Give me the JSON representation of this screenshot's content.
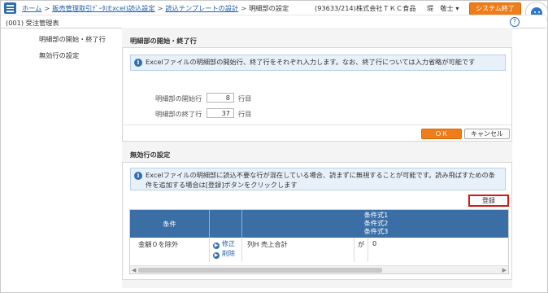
{
  "header": {
    "breadcrumbs": [
      {
        "label": "ホーム"
      },
      {
        "label": "販売管理取引ﾃﾞｰﾀ(Excel)読込設定"
      },
      {
        "label": "読込テンプレートの設計"
      }
    ],
    "current": "明細部の設定",
    "company": "(93633/214)株式会社ＴＫＣ食品",
    "user": "堤　敬士 ▾",
    "system_end_label": "システム終了"
  },
  "subheader": {
    "title": "(001) 受注管理表",
    "help_label": "?"
  },
  "leftnav": {
    "items": [
      {
        "label": "明細部の開始・終了行"
      },
      {
        "label": "無効行の設定"
      }
    ]
  },
  "detail_section": {
    "title": "明細部の開始・終了行",
    "info": "Excelファイルの明細部の開始行、終了行をそれぞれ入力します。なお、終了行については入力省略が可能です",
    "start_label": "明細部の開始行",
    "start_value": "8",
    "end_label": "明細部の終了行",
    "end_value": "37",
    "unit": "行目",
    "ok_label": "ＯＫ",
    "cancel_label": "キャンセル"
  },
  "invalid_section": {
    "title": "無効行の設定",
    "info_line1": "Excelファイルの明細部に読込不要な行が混在している場合、読まずに無視することが可能です。読み飛ばすための条",
    "info_line2": "件を追加する場合は[登録]ボタンをクリックします",
    "register_label": "登録",
    "table": {
      "headers": {
        "condition": "条件",
        "expr1": "条件式1",
        "expr2": "条件式2",
        "expr3": "条件式3"
      },
      "rows": [
        {
          "condition": "金額０を除外",
          "edit": "修正",
          "delete": "削除",
          "expr": "列H 売上合計",
          "op": "が",
          "value": "0"
        }
      ]
    }
  },
  "colors": {
    "accent_orange": "#ee7d1a",
    "header_blue": "#3a6ea5",
    "link_blue": "#1f5fa8",
    "highlight_red": "#d11b1b"
  }
}
